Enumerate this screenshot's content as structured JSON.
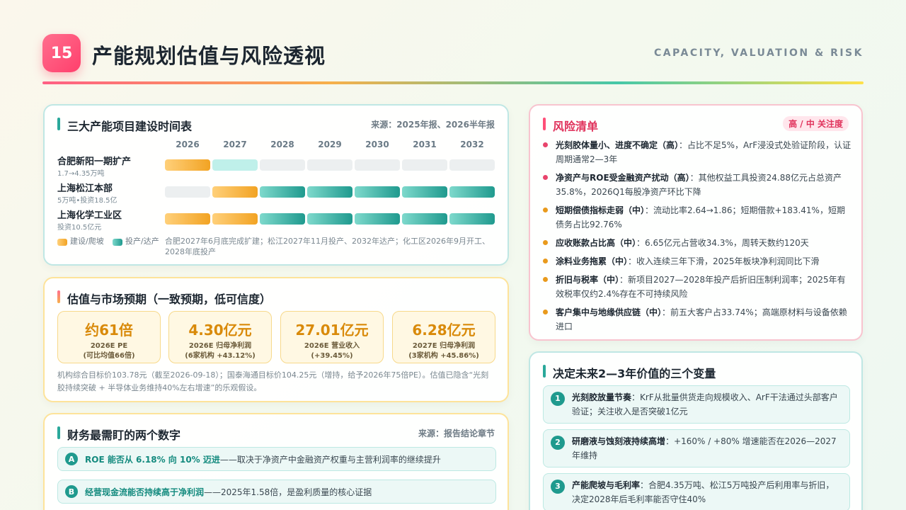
{
  "header": {
    "number": "15",
    "title": "产能规划估值与风险透视",
    "subtitle": "CAPACITY, VALUATION & RISK"
  },
  "timeline": {
    "title": "三大产能项目建设时间表",
    "source": "来源：2025年报、2026半年报",
    "years": [
      "2026",
      "2027",
      "2028",
      "2029",
      "2030",
      "2031",
      "2032"
    ],
    "projects": [
      {
        "name": "合肥新阳一期扩产",
        "sub": "1.7→4.35万吨",
        "phases": [
          "build",
          "light",
          "none",
          "none",
          "none",
          "none",
          "none"
        ]
      },
      {
        "name": "上海松江本部",
        "sub": "5万吨•投资18.5亿",
        "phases": [
          "none",
          "build",
          "prod",
          "prod",
          "prod",
          "prod",
          "prod"
        ]
      },
      {
        "name": "上海化学工业区",
        "sub": "投资10.5亿元",
        "phases": [
          "build",
          "build",
          "prod",
          "prod",
          "prod",
          "prod",
          "prod"
        ]
      }
    ],
    "legend_build": "建设/爬坡",
    "legend_prod": "投产/达产",
    "note": "合肥2027年6月底完成扩建；松江2027年11月投产、2032年达产；化工区2026年9月开工、2028年底投产",
    "colors": {
      "build": "#f2a323",
      "prod": "#1f9a8e"
    }
  },
  "valuation": {
    "title": "估值与市场预期（一致预期，低可信度）",
    "metrics": [
      {
        "value": "约61倍",
        "line1": "2026E PE",
        "line2": "(可比均值66倍)"
      },
      {
        "value": "4.30亿元",
        "line1": "2026E 归母净利润",
        "line2": "(6家机构 +43.12%)"
      },
      {
        "value": "27.01亿元",
        "line1": "2026E 营业收入",
        "line2": "(+39.45%)"
      },
      {
        "value": "6.28亿元",
        "line1": "2027E 归母净利润",
        "line2": "(3家机构 +45.86%)"
      }
    ],
    "note": "机构综合目标价103.78元（截至2026-09-18）；国泰海通目标价104.25元（增持，给予2026年75倍PE）。估值已隐含“光刻胶持续突破 + 半导体业务维持40%左右增速”的乐观假设。"
  },
  "finance": {
    "title": "财务最需盯的两个数字",
    "source": "来源：报告结论章节",
    "items": [
      {
        "badge": "A",
        "strong": "ROE 能否从 6.18% 向 10% 迈进",
        "text": "——取决于净资产中金融资产权重与主营利润率的继续提升"
      },
      {
        "badge": "B",
        "strong": "经营现金流能否持续高于净利润",
        "text": "——2025年1.58倍，是盈利质量的核心证据"
      }
    ]
  },
  "risks": {
    "title": "风险清单",
    "badge": "高 / 中 关注度",
    "items": [
      {
        "level": "high",
        "strong": "光刻胶体量小、进度不确定（高）",
        "text": "：占比不足5%，ArF浸没式处验证阶段，认证周期通常2—3年"
      },
      {
        "level": "high",
        "strong": "净资产与ROE受金融资产扰动（高）",
        "text": "：其他权益工具投资24.88亿元占总资产35.8%，2026Q1每股净资产环比下降"
      },
      {
        "level": "mid",
        "strong": "短期偿债指标走弱（中）",
        "text": "：流动比率2.64→1.86；短期借款+183.41%，短期债务占比92.76%"
      },
      {
        "level": "mid",
        "strong": "应收账款占比高（中）",
        "text": "：6.65亿元占营收34.3%，周转天数约120天"
      },
      {
        "level": "mid",
        "strong": "涂料业务拖累（中）",
        "text": "：收入连续三年下滑，2025年板块净利润同比下滑"
      },
      {
        "level": "mid",
        "strong": "折旧与税率（中）",
        "text": "：新项目2027—2028年投产后折旧压制利润率；2025年有效税率仅约2.4%存在不可持续风险"
      },
      {
        "level": "mid",
        "strong": "客户集中与地缘供应链（中）",
        "text": "：前五大客户占33.74%；高端原材料与设备依赖进口"
      }
    ],
    "colors": {
      "high": "#e8446c",
      "mid": "#e99a1c"
    }
  },
  "variables": {
    "title": "决定未来2—3年价值的三个变量",
    "items": [
      {
        "badge": "1",
        "strong": "光刻胶放量节奏",
        "text": "：KrF从批量供货走向规模收入、ArF干法通过头部客户验证；关注收入是否突破1亿元"
      },
      {
        "badge": "2",
        "strong": "研磨液与蚀刻液持续高增",
        "text": "：+160% / +80% 增速能否在2026—2027年维持"
      },
      {
        "badge": "3",
        "strong": "产能爬坡与毛利率",
        "text": "：合肥4.35万吨、松江5万吨投产后利用率与折旧，决定2028年后毛利率能否守住40%"
      }
    ]
  }
}
